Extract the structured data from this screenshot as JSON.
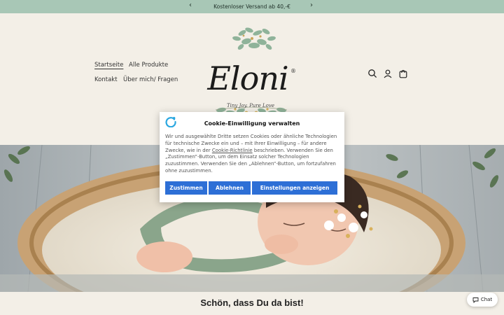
{
  "announcement": {
    "text": "Kostenloser Versand ab 40,-€",
    "prev_arrow": "‹",
    "next_arrow": "›"
  },
  "nav": {
    "items": [
      {
        "label": "Startseite",
        "active": true
      },
      {
        "label": "Alle Produkte"
      },
      {
        "label": "Kontakt"
      },
      {
        "label": "Über mich/ Fragen"
      }
    ]
  },
  "logo": {
    "wordmark": "Eloni",
    "registered": "®",
    "tagline": "Tiny Joy. Pure Love"
  },
  "header_icons": [
    "search-icon",
    "account-icon",
    "cart-icon"
  ],
  "cookie_dialog": {
    "title": "Cookie-Einwilligung verwalten",
    "body_before_link": "Wir und ausgewählte Dritte setzen Cookies oder ähnliche Technologien für technische Zwecke ein und – mit Ihrer Einwilligung – für andere Zwecke, wie in der ",
    "link_text": "Cookie-Richtlinie",
    "body_after_link": " beschrieben. Verwenden Sie den „Zustimmen“-Button, um dem Einsatz solcher Technologien zuzustimmen. Verwenden Sie den „Ablehnen“-Button, um fortzufahren ohne zuzustimmen.",
    "accept_label": "Zustimmen",
    "decline_label": "Ablehnen",
    "settings_label": "Einstellungen anzeigen",
    "button_color": "#2d6fd6"
  },
  "welcome": {
    "title": "Schön, dass Du da bist!"
  },
  "chat": {
    "label": "Chat"
  },
  "colors": {
    "announcement_bg": "#a8c7b6",
    "page_bg": "#f3efe7",
    "accent_blue": "#2d6fd6"
  }
}
